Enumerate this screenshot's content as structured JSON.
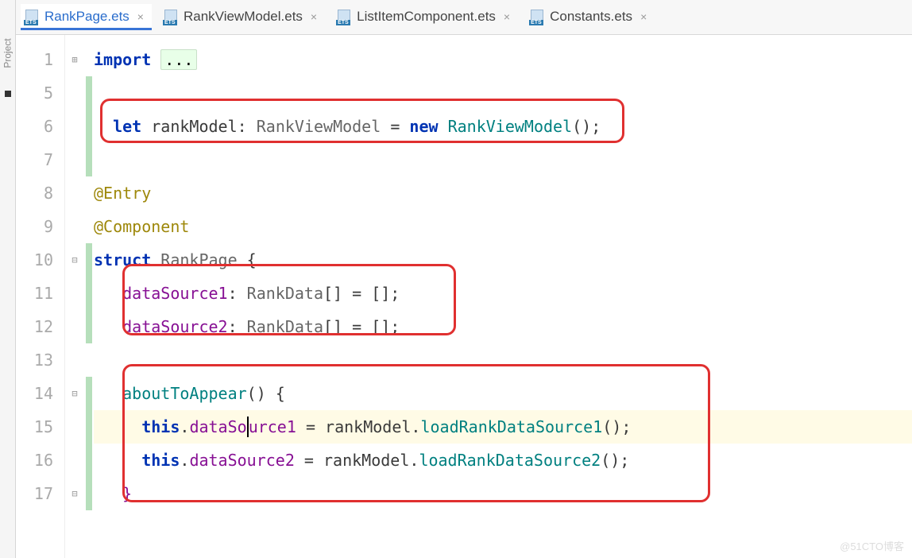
{
  "side_panel_label": "Project",
  "tabs": [
    {
      "label": "RankPage.ets",
      "active": true
    },
    {
      "label": "RankViewModel.ets",
      "active": false
    },
    {
      "label": "ListItemComponent.ets",
      "active": false
    },
    {
      "label": "Constants.ets",
      "active": false
    }
  ],
  "line_numbers": [
    "1",
    "5",
    "6",
    "7",
    "8",
    "9",
    "10",
    "11",
    "12",
    "13",
    "14",
    "15",
    "16",
    "17"
  ],
  "code": {
    "l1": {
      "import": "import ",
      "dots": "..."
    },
    "l6": {
      "let": "let ",
      "var": "rankModel",
      "colon": ": ",
      "type": "RankViewModel",
      "eq": " = ",
      "new": "new ",
      "ctor": "RankViewModel",
      "tail": "();"
    },
    "l8": "@Entry",
    "l9": "@Component",
    "l10": {
      "struct": "struct ",
      "name": "RankPage",
      "brace": " {"
    },
    "l11": {
      "prop": "dataSource1",
      "colon": ": ",
      "type": "RankData",
      "arr": "[] = [];"
    },
    "l12": {
      "prop": "dataSource2",
      "colon": ": ",
      "type": "RankData",
      "arr": "[] = [];"
    },
    "l14": {
      "fn": "aboutToAppear",
      "rest": "() {"
    },
    "l15": {
      "this": "this",
      "dot": ".",
      "propA": "dataSo",
      "propB": "urce1",
      "eq": " = ",
      "obj": "rankModel",
      "dot2": ".",
      "call": "loadRankDataSource1",
      "tail": "();"
    },
    "l16": {
      "this": "this",
      "dot": ".",
      "prop": "dataSource2",
      "eq": " = ",
      "obj": "rankModel",
      "dot2": ".",
      "call": "loadRankDataSource2",
      "tail": "();"
    },
    "l17": "}"
  },
  "watermark": "@51CTO博客"
}
